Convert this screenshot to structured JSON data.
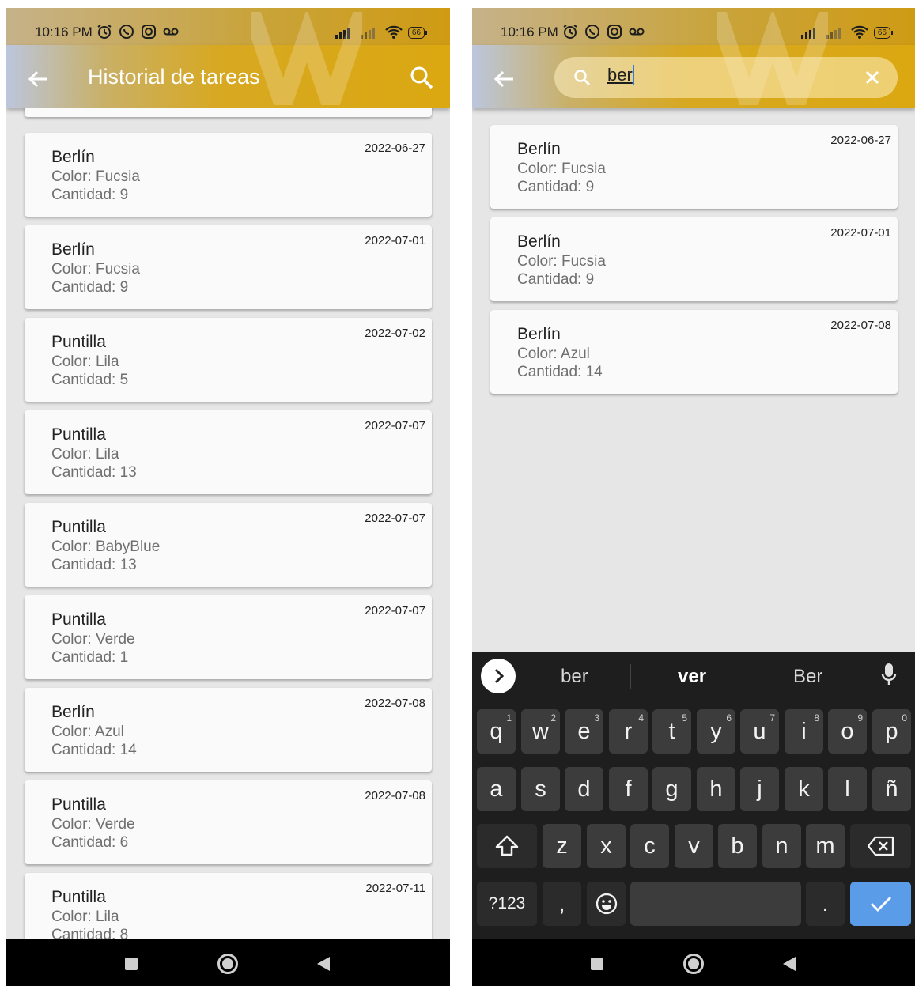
{
  "status_bar": {
    "time": "10:16 PM",
    "battery": "66"
  },
  "screen_left": {
    "title": "Historial de tareas",
    "tasks": [
      {
        "name": "Berlín",
        "color": "Color: Fucsia",
        "qty": "Cantidad: 9",
        "date": "2022-06-27"
      },
      {
        "name": "Berlín",
        "color": "Color: Fucsia",
        "qty": "Cantidad: 9",
        "date": "2022-07-01"
      },
      {
        "name": "Puntilla",
        "color": "Color: Lila",
        "qty": "Cantidad: 5",
        "date": "2022-07-02"
      },
      {
        "name": "Puntilla",
        "color": "Color: Lila",
        "qty": "Cantidad: 13",
        "date": "2022-07-07"
      },
      {
        "name": "Puntilla",
        "color": "Color: BabyBlue",
        "qty": "Cantidad: 13",
        "date": "2022-07-07"
      },
      {
        "name": "Puntilla",
        "color": "Color: Verde",
        "qty": "Cantidad: 1",
        "date": "2022-07-07"
      },
      {
        "name": "Berlín",
        "color": "Color: Azul",
        "qty": "Cantidad: 14",
        "date": "2022-07-08"
      },
      {
        "name": "Puntilla",
        "color": "Color: Verde",
        "qty": "Cantidad: 6",
        "date": "2022-07-08"
      },
      {
        "name": "Puntilla",
        "color": "Color: Lila",
        "qty": "Cantidad: 8",
        "date": "2022-07-11"
      }
    ]
  },
  "screen_right": {
    "search_query": "ber",
    "results": [
      {
        "name": "Berlín",
        "color": "Color: Fucsia",
        "qty": "Cantidad: 9",
        "date": "2022-06-27"
      },
      {
        "name": "Berlín",
        "color": "Color: Fucsia",
        "qty": "Cantidad: 9",
        "date": "2022-07-01"
      },
      {
        "name": "Berlín",
        "color": "Color: Azul",
        "qty": "Cantidad: 14",
        "date": "2022-07-08"
      }
    ],
    "keyboard": {
      "suggestions": [
        "ber",
        "ver",
        "Ber"
      ],
      "row1": [
        "q",
        "w",
        "e",
        "r",
        "t",
        "y",
        "u",
        "i",
        "o",
        "p"
      ],
      "row1_hints": [
        "1",
        "2",
        "3",
        "4",
        "5",
        "6",
        "7",
        "8",
        "9",
        "0"
      ],
      "row2": [
        "a",
        "s",
        "d",
        "f",
        "g",
        "h",
        "j",
        "k",
        "l",
        "ñ"
      ],
      "row3": [
        "z",
        "x",
        "c",
        "v",
        "b",
        "n",
        "m"
      ],
      "mode_key": "?123",
      "comma_key": ",",
      "period_key": "."
    }
  },
  "colors": {
    "appbar_gold": "#d7a821",
    "keyboard_bg": "#1e1e1e",
    "enter_key": "#5b9ce8"
  }
}
